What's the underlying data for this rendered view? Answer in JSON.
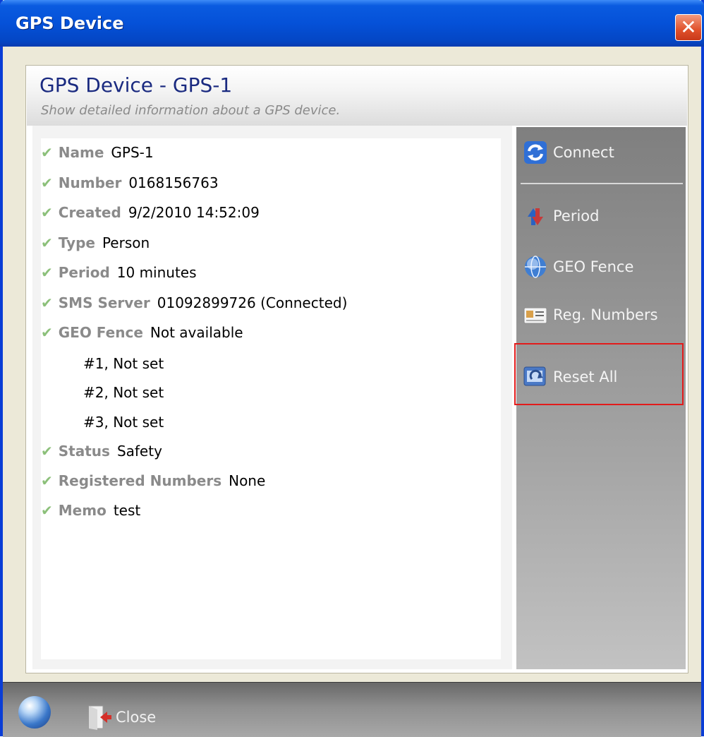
{
  "window": {
    "title": "GPS Device",
    "close_glyph": "✕"
  },
  "header": {
    "title": "GPS Device - GPS-1",
    "subtitle": "Show detailed information about a GPS device."
  },
  "details": [
    {
      "label": "Name",
      "value": "GPS-1"
    },
    {
      "label": "Number",
      "value": "0168156763"
    },
    {
      "label": "Created",
      "value": "9/2/2010 14:52:09"
    },
    {
      "label": "Type",
      "value": "Person"
    },
    {
      "label": "Period",
      "value": "10 minutes"
    },
    {
      "label": "SMS Server",
      "value": "01092899726 (Connected)"
    },
    {
      "label": "GEO Fence",
      "value": "Not available"
    },
    {
      "label": "Status",
      "value": "Safety"
    },
    {
      "label": "Registered Numbers",
      "value": "None"
    },
    {
      "label": "Memo",
      "value": "test"
    }
  ],
  "geo_fence_items": [
    "#1, Not set",
    "#2, Not set",
    "#3, Not set"
  ],
  "check_glyph": "✔",
  "actions": {
    "connect": "Connect",
    "period": "Period",
    "geo_fence": "GEO Fence",
    "reg_numbers": "Reg. Numbers",
    "reset_all": "Reset All"
  },
  "footer": {
    "close": "Close"
  },
  "icons": {
    "connect": "refresh-icon",
    "period": "period-arrows-icon",
    "geo_fence": "globe-icon",
    "reg_numbers": "id-card-icon",
    "reset_all": "reset-icon",
    "globe": "globe-icon",
    "close": "exit-door-icon"
  },
  "colors": {
    "titlebar": "#0551d8",
    "header_title": "#1a2a80",
    "label_gray": "#8a8a8a",
    "check_green": "#8cc07a",
    "highlight_red": "#e21b1b"
  }
}
